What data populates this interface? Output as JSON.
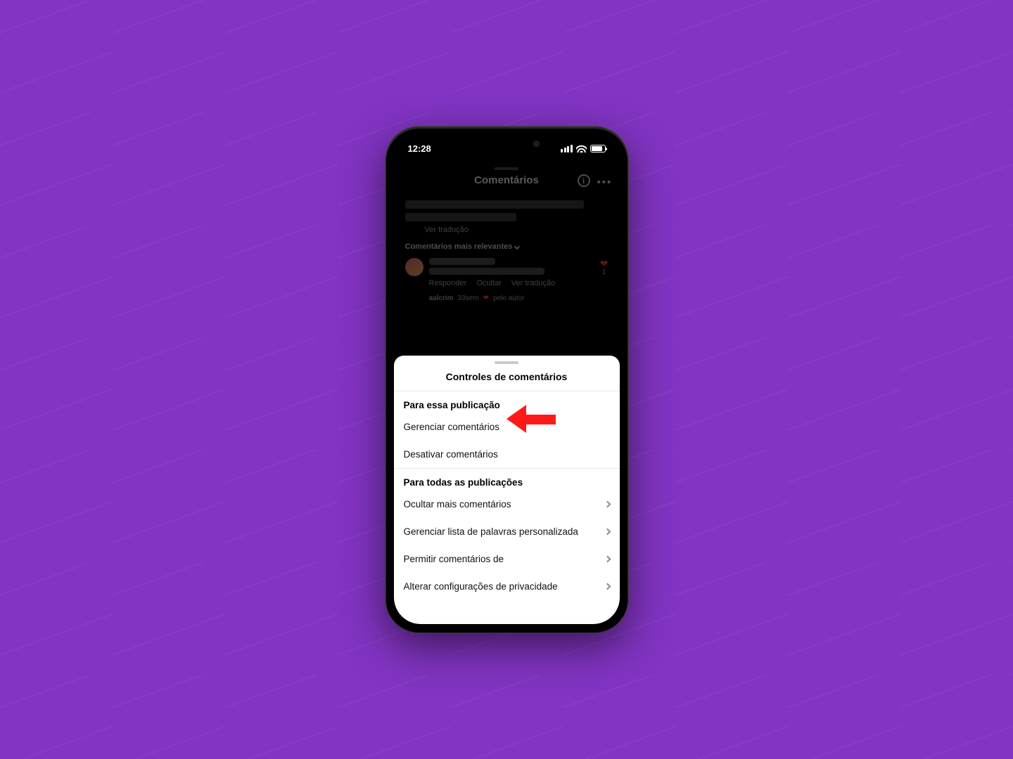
{
  "status_bar": {
    "time": "12:28"
  },
  "app_header": {
    "title": "Comentários",
    "info_glyph": "i"
  },
  "dimmed_area": {
    "translate_link": "Ver tradução",
    "sort_label": "Comentários mais relevantes",
    "actions": {
      "reply": "Responder",
      "hide": "Ocultar",
      "translate": "Ver tradução"
    },
    "like_count": "1",
    "reply_author": "aalcrim",
    "reply_age": "33sem",
    "reply_by_author": "pelo autor"
  },
  "sheet": {
    "title": "Controles de comentários",
    "section_this": "Para essa publicação",
    "section_all": "Para todas as publicações",
    "items_this": {
      "manage": "Gerenciar comentários",
      "disable": "Desativar comentários"
    },
    "items_all": {
      "hide_more": "Ocultar mais comentários",
      "custom_words": "Gerenciar lista de palavras personalizada",
      "allow_from": "Permitir comentários de",
      "privacy": "Alterar configurações de privacidade"
    }
  },
  "annotation": {
    "target": "Gerenciar comentários"
  }
}
